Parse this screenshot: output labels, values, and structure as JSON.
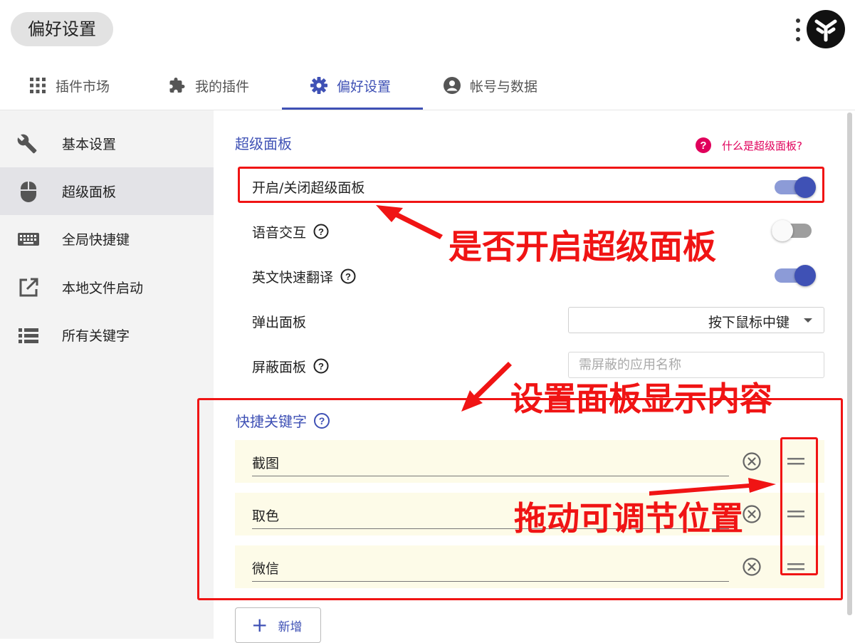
{
  "header": {
    "title": "偏好设置"
  },
  "tabs": [
    {
      "label": "插件市场",
      "icon": "apps-grid-icon"
    },
    {
      "label": "我的插件",
      "icon": "puzzle-icon"
    },
    {
      "label": "偏好设置",
      "icon": "gear-icon",
      "active": true
    },
    {
      "label": "帐号与数据",
      "icon": "account-circle-icon"
    }
  ],
  "sidebar": {
    "items": [
      {
        "label": "基本设置",
        "icon": "wrench-icon"
      },
      {
        "label": "超级面板",
        "icon": "mouse-icon",
        "active": true
      },
      {
        "label": "全局快捷键",
        "icon": "keyboard-icon"
      },
      {
        "label": "本地文件启动",
        "icon": "open-external-icon"
      },
      {
        "label": "所有关键字",
        "icon": "list-icon"
      }
    ]
  },
  "superpanel": {
    "title": "超级面板",
    "help_link": "什么是超级面板?",
    "toggle_label": "开启/关闭超级面板",
    "toggle_on": true,
    "voice_label": "语音交互",
    "voice_on": false,
    "translate_label": "英文快速翻译",
    "translate_on": true,
    "popup_label": "弹出面板",
    "popup_value": "按下鼠标中键",
    "block_label": "屏蔽面板",
    "block_placeholder": "需屏蔽的应用名称"
  },
  "keywords": {
    "title": "快捷关键字",
    "items": [
      "截图",
      "取色",
      "微信"
    ],
    "add_label": "新增"
  },
  "annotations": {
    "toggle_note": "是否开启超级面板",
    "content_note": "设置面板显示内容",
    "drag_note": "拖动可调节位置"
  },
  "colors": {
    "accent": "#3f51b5",
    "help": "#e0005b",
    "annotation": "#f01414",
    "keyword_bg": "#fdfbe8"
  }
}
